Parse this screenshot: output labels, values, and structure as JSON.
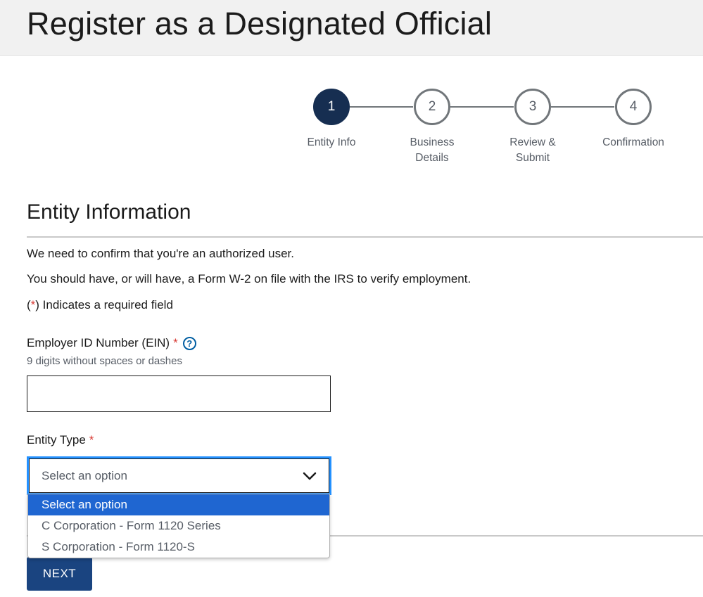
{
  "page": {
    "title": "Register as a Designated Official"
  },
  "stepper": {
    "steps": [
      {
        "number": "1",
        "label": "Entity Info",
        "state": "active"
      },
      {
        "number": "2",
        "label": "Business Details",
        "state": "upcoming"
      },
      {
        "number": "3",
        "label": "Review & Submit",
        "state": "upcoming"
      },
      {
        "number": "4",
        "label": "Confirmation",
        "state": "upcoming"
      }
    ]
  },
  "section": {
    "title": "Entity Information",
    "intro_1": "We need to confirm that you're an authorized user.",
    "intro_2": "You should have, or will have, a Form W-2 on file with the IRS to verify employment.",
    "required_open": "(",
    "required_star": "*",
    "required_close": ") Indicates a required field"
  },
  "ein_field": {
    "label": "Employer ID Number (EIN)",
    "required_marker": "*",
    "help_icon": "?",
    "hint": "9 digits without spaces or dashes",
    "value": ""
  },
  "entity_type": {
    "label": "Entity Type",
    "required_marker": "*",
    "selected": "Select an option",
    "options": [
      "Select an option",
      "C Corporation - Form 1120 Series",
      "S Corporation - Form 1120-S"
    ],
    "highlighted_index": 0
  },
  "actions": {
    "next_label": "NEXT"
  },
  "icons": {
    "help": "question-circle-icon",
    "chevron": "chevron-down-icon"
  },
  "colors": {
    "active_step": "#162e51",
    "focus_outline": "#2491ff",
    "option_highlight": "#1f66d1",
    "button": "#1a4480",
    "required": "#d83933",
    "help_icon": "#005ea2"
  }
}
